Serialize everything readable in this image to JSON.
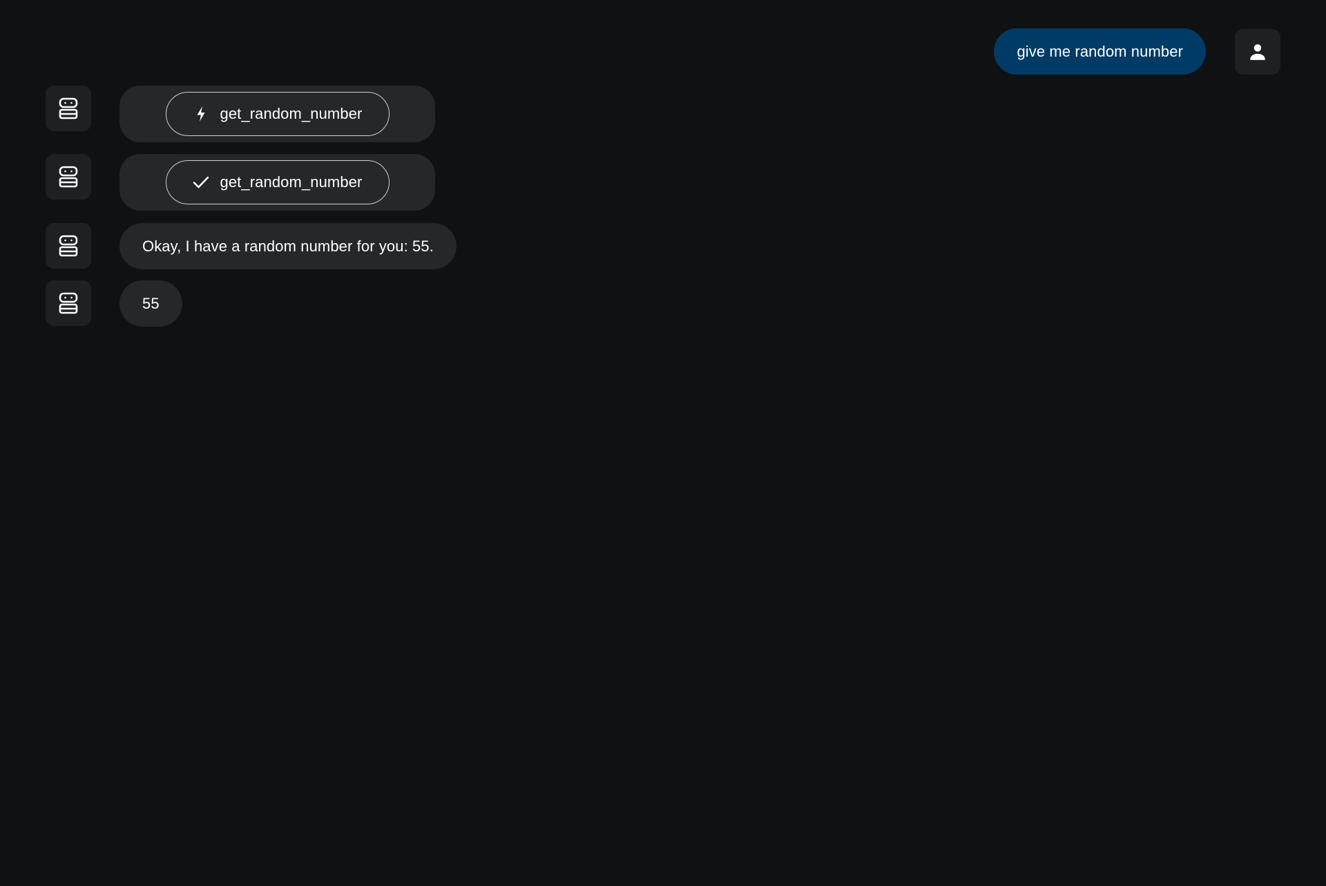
{
  "colors": {
    "background": "#101113",
    "bot_bubble": "#25272b",
    "user_bubble": "#003b66",
    "avatar_bg": "#1e2024",
    "chip_border": "#cfd1d4"
  },
  "user_message": {
    "text": "give me random number",
    "avatar_icon": "person-icon"
  },
  "messages": [
    {
      "type": "tool_call",
      "status": "running",
      "status_icon": "lightning-bolt-icon",
      "tool_name": "get_random_number",
      "avatar_icon": "robot-icon"
    },
    {
      "type": "tool_result",
      "status": "completed",
      "status_icon": "check-icon",
      "tool_name": "get_random_number",
      "avatar_icon": "robot-icon"
    },
    {
      "type": "text",
      "text": "Okay, I have a random number for you: 55.",
      "avatar_icon": "robot-icon"
    },
    {
      "type": "text",
      "text": "55",
      "avatar_icon": "robot-icon"
    }
  ]
}
